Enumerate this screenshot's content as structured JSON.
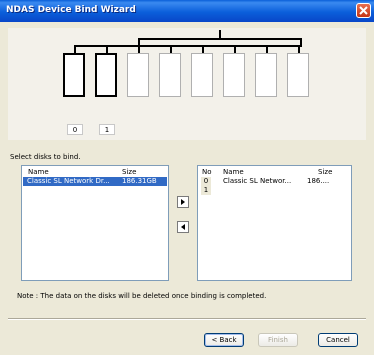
{
  "window": {
    "title": "NDAS Device Bind Wizard"
  },
  "diagram": {
    "slot_labels": [
      "0",
      "1"
    ],
    "bound_count": 2,
    "total_slots": 8
  },
  "instructions": "Select disks to bind.",
  "available_list": {
    "columns": {
      "name": "Name",
      "size": "Size"
    },
    "rows": [
      {
        "name": "Classic SL Network Dr...",
        "size": "186.31GB",
        "selected": true
      }
    ]
  },
  "bind_list": {
    "columns": {
      "no": "No",
      "name": "Name",
      "size": "Size"
    },
    "rows": [
      {
        "no": "0",
        "name": "Classic SL Networ...",
        "size": "186...."
      },
      {
        "no": "1",
        "name": "",
        "size": ""
      }
    ]
  },
  "note": "Note : The data on the disks will be deleted once binding is completed.",
  "buttons": {
    "back": "< Back",
    "finish": "Finish",
    "cancel": "Cancel"
  },
  "colors": {
    "selection": "#316ac5",
    "title_bar": "#0b5fdb",
    "close": "#c63414"
  }
}
